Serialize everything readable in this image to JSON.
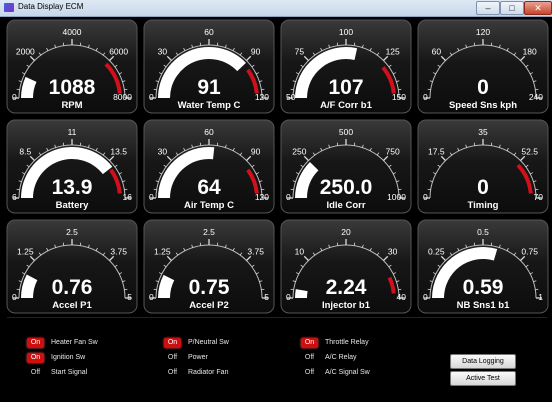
{
  "window": {
    "title": "Data Display ECM",
    "min": "–",
    "max": "□",
    "close": "✕"
  },
  "gauges": [
    {
      "label": "RPM",
      "value": "1088",
      "min_label": "0",
      "max_label": "8000",
      "ticks": [
        "2000",
        "4000",
        "6000"
      ],
      "fill": 0.136,
      "redline": 0.75
    },
    {
      "label": "Water Temp C",
      "value": "91",
      "min_label": "0",
      "max_label": "120",
      "ticks": [
        "30",
        "60",
        "90"
      ],
      "fill": 0.758,
      "redline": 0.8
    },
    {
      "label": "A/F Corr b1",
      "value": "107",
      "min_label": "50",
      "max_label": "150",
      "ticks": [
        "75",
        "100",
        "125"
      ],
      "fill": 0.57,
      "redline": 0.78
    },
    {
      "label": "Speed Sns kph",
      "value": "0",
      "min_label": "0",
      "max_label": "240",
      "ticks": [
        "60",
        "120",
        "180"
      ],
      "fill": 0.0,
      "redline": null
    },
    {
      "label": "Battery",
      "value": "13.9",
      "min_label": "6",
      "max_label": "16",
      "ticks": [
        "8.5",
        "11",
        "13.5"
      ],
      "fill": 0.79,
      "redline": 0.8
    },
    {
      "label": "Air Temp C",
      "value": "64",
      "min_label": "0",
      "max_label": "120",
      "ticks": [
        "30",
        "60",
        "90"
      ],
      "fill": 0.533,
      "redline": 0.8
    },
    {
      "label": "Idle Corr",
      "value": "250.0",
      "min_label": "0",
      "max_label": "1000",
      "ticks": [
        "250",
        "500",
        "750"
      ],
      "fill": 0.25,
      "redline": null
    },
    {
      "label": "Timing",
      "value": "0",
      "min_label": "0",
      "max_label": "70",
      "ticks": [
        "17.5",
        "35",
        "52.5"
      ],
      "fill": 0.0,
      "redline": 0.76
    },
    {
      "label": "Accel P1",
      "value": "0.76",
      "min_label": "0",
      "max_label": "5",
      "ticks": [
        "1.25",
        "2.5",
        "3.75"
      ],
      "fill": 0.152,
      "redline": null
    },
    {
      "label": "Accel P2",
      "value": "0.75",
      "min_label": "0",
      "max_label": "5",
      "ticks": [
        "1.25",
        "2.5",
        "3.75"
      ],
      "fill": 0.15,
      "redline": null
    },
    {
      "label": "Injector b1",
      "value": "2.24",
      "min_label": "0",
      "max_label": "40",
      "ticks": [
        "10",
        "20",
        "30"
      ],
      "fill": 0.056,
      "redline": 0.86
    },
    {
      "label": "NB Sns1 b1",
      "value": "0.59",
      "min_label": "0",
      "max_label": "1",
      "ticks": [
        "0.25",
        "0.5",
        "0.75"
      ],
      "fill": 0.59,
      "redline": null
    }
  ],
  "switches": [
    {
      "state": "On",
      "label": "Heater Fan Sw"
    },
    {
      "state": "On",
      "label": "Ignition Sw"
    },
    {
      "state": "Off",
      "label": "Start Signal"
    },
    {
      "state": "On",
      "label": "P/Neutral Sw"
    },
    {
      "state": "Off",
      "label": "Power"
    },
    {
      "state": "Off",
      "label": "Radiator Fan"
    },
    {
      "state": "On",
      "label": "Throttle Relay"
    },
    {
      "state": "Off",
      "label": "A/C Relay"
    },
    {
      "state": "Off",
      "label": "A/C Signal Sw"
    }
  ],
  "buttons": {
    "data_logging": "Data Logging",
    "active_test": "Active Test"
  },
  "colors": {
    "fill": "#ffffff",
    "redline": "#d0101a",
    "gauge_bg": "#1a1a1a",
    "led_on": "#cc1010"
  }
}
